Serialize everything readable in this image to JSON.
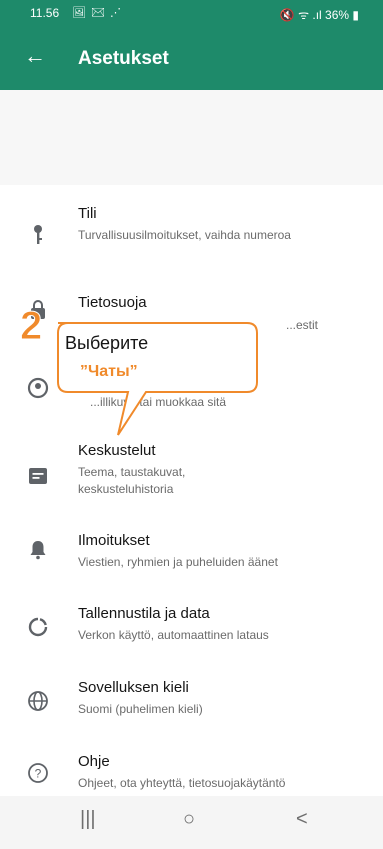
{
  "status_bar": {
    "time": "11.56",
    "left_icons": "🖼 ✉ ⋰",
    "right_text": "🔇 ᯤ .ıl 36% ▮"
  },
  "app_bar": {
    "title": "Asetukset",
    "back_icon": "←"
  },
  "settings": [
    {
      "icon": "key-icon",
      "title": "Tili",
      "subtitle": "Turvallisuusilmoitukset, vaihda numeroa"
    },
    {
      "icon": "lock-icon",
      "title": "Tietosuoja",
      "subtitle": "...estit"
    },
    {
      "icon": "avatar-icon",
      "title": "",
      "subtitle": "...illikuva tai muokkaa sitä"
    },
    {
      "icon": "chat-icon",
      "title": "Keskustelut",
      "subtitle": "Teema, taustakuvat, keskusteluhistoria"
    },
    {
      "icon": "bell-icon",
      "title": "Ilmoitukset",
      "subtitle": "Viestien, ryhmien ja puheluiden äänet"
    },
    {
      "icon": "data-usage-icon",
      "title": "Tallennustila ja data",
      "subtitle": "Verkon käyttö, automaattinen lataus"
    },
    {
      "icon": "globe-icon",
      "title": "Sovelluksen kieli",
      "subtitle": "Suomi (puhelimen kieli)"
    },
    {
      "icon": "help-icon",
      "title": "Ohje",
      "subtitle": "Ohjeet, ota yhteyttä, tietosuojakäytäntö"
    }
  ],
  "callout": {
    "number": "2",
    "line1": "Выберите",
    "line2": "”Чаты”",
    "accent_color": "#f08a2b"
  },
  "nav_bar": {
    "recents": "|||",
    "home": "○",
    "back": "<"
  },
  "colors": {
    "app_bar": "#1e8a6a",
    "accent": "#f08a2b"
  }
}
